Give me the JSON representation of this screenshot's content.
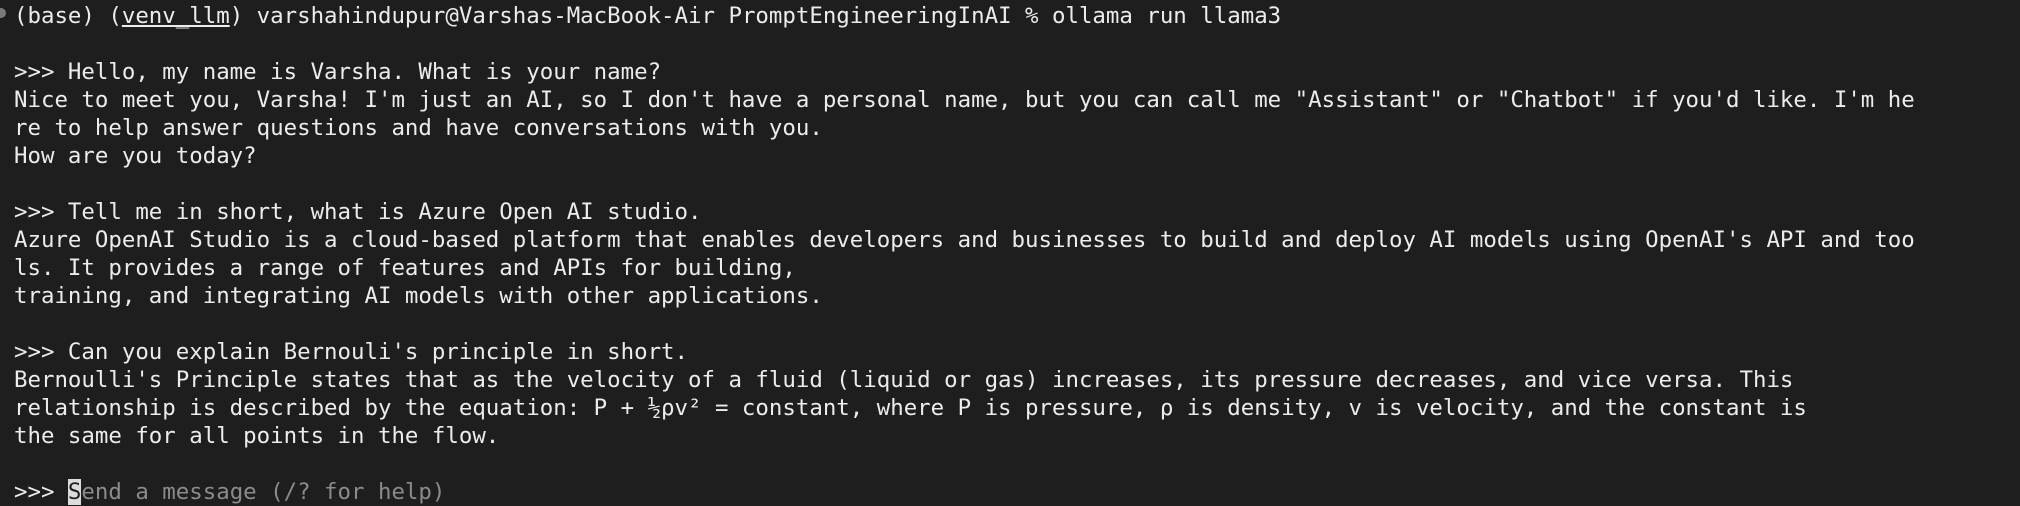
{
  "terminal": {
    "command_line": {
      "env_prefix": "(base) (",
      "venv": "venv_llm",
      "rest": ") varshahindupur@Varshas-MacBook-Air PromptEngineeringInAI % ollama run llama3"
    },
    "exchanges": [
      {
        "prompt": ">>> Hello, my name is Varsha. What is your name?",
        "response": [
          "Nice to meet you, Varsha! I'm just an AI, so I don't have a personal name, but you can call me \"Assistant\" or \"Chatbot\" if you'd like. I'm he",
          "re to help answer questions and have conversations with you.",
          "How are you today?"
        ]
      },
      {
        "prompt": ">>> Tell me in short, what is Azure Open AI studio.",
        "response": [
          "Azure OpenAI Studio is a cloud-based platform that enables developers and businesses to build and deploy AI models using OpenAI's API and too",
          "ls. It provides a range of features and APIs for building,",
          "training, and integrating AI models with other applications."
        ]
      },
      {
        "prompt": ">>> Can you explain Bernouli's principle in short.",
        "response": [
          "Bernoulli's Principle states that as the velocity of a fluid (liquid or gas) increases, its pressure decreases, and vice versa. This",
          "relationship is described by the equation: P + ½ρv² = constant, where P is pressure, ρ is density, v is velocity, and the constant is",
          "the same for all points in the flow."
        ]
      }
    ],
    "input": {
      "prompt": ">>> ",
      "cursor_char": "S",
      "placeholder_rest": "end a message (/? for help)"
    }
  }
}
